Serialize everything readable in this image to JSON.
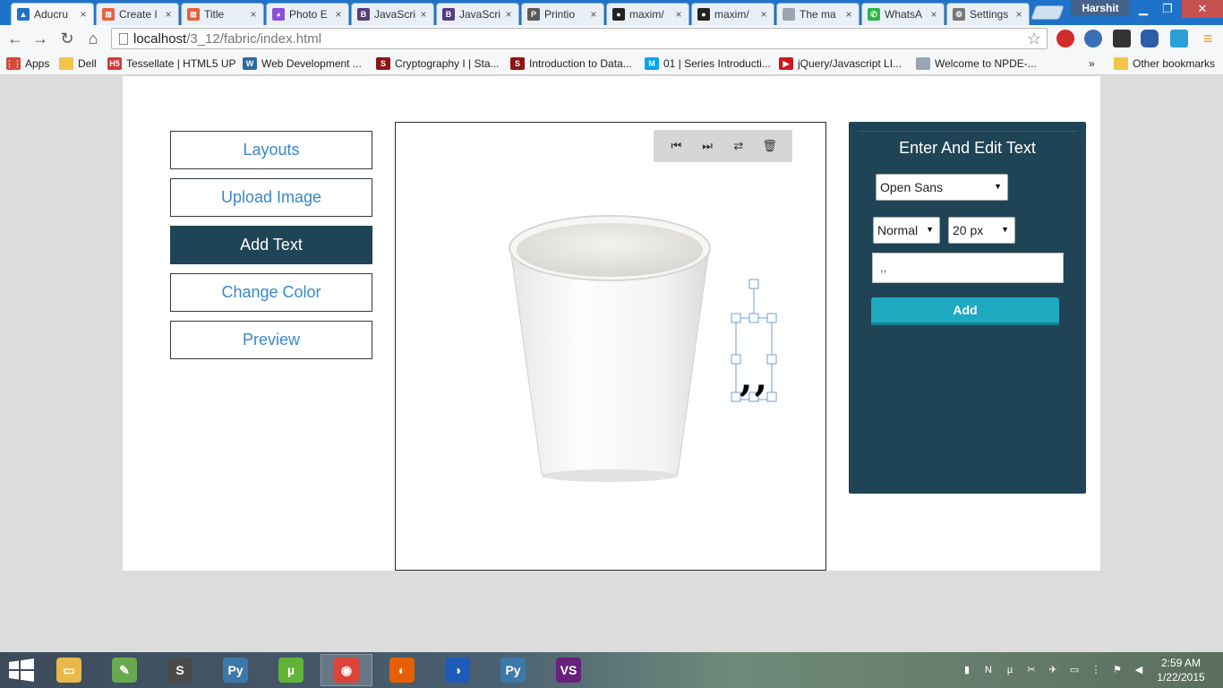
{
  "browser": {
    "tabs": [
      {
        "label": "Aducru",
        "active": true,
        "icon": "aducru-icon",
        "color": "#1e73c8",
        "glyph": "▲"
      },
      {
        "label": "Create I",
        "active": false,
        "icon": "xampp-icon",
        "color": "#e8603c",
        "glyph": "⊠"
      },
      {
        "label": "Title",
        "active": false,
        "icon": "xampp-icon",
        "color": "#e8603c",
        "glyph": "⊠"
      },
      {
        "label": "Photo E",
        "active": false,
        "icon": "colorwheel-icon",
        "color": "#8a4fd8",
        "glyph": "◕"
      },
      {
        "label": "JavaScri",
        "active": false,
        "icon": "bootstrap-icon",
        "color": "#563d7c",
        "glyph": "B"
      },
      {
        "label": "JavaScri",
        "active": false,
        "icon": "bootstrap-icon",
        "color": "#563d7c",
        "glyph": "B"
      },
      {
        "label": "Printio",
        "active": false,
        "icon": "printio-icon",
        "color": "#5a5a5a",
        "glyph": "P"
      },
      {
        "label": "maxim/",
        "active": false,
        "icon": "github-icon",
        "color": "#222222",
        "glyph": "●"
      },
      {
        "label": "maxim/",
        "active": false,
        "icon": "github-icon",
        "color": "#222222",
        "glyph": "●"
      },
      {
        "label": "The ma",
        "active": false,
        "icon": "page-icon",
        "color": "#9aa5b1",
        "glyph": ""
      },
      {
        "label": "WhatsA",
        "active": false,
        "icon": "whatsapp-icon",
        "color": "#2bb741",
        "glyph": "✆"
      },
      {
        "label": "Settings",
        "active": false,
        "icon": "gear-icon",
        "color": "#777777",
        "glyph": "⚙"
      }
    ],
    "profile_name": "Harshit",
    "url_host": "localhost",
    "url_path": "/3_12/fabric/index.html",
    "bookmarks": [
      {
        "label": "Apps",
        "icon": "apps-grid-icon",
        "color": "#d24a3a",
        "glyph": "⋮⋮"
      },
      {
        "label": "Dell",
        "icon": "folder-icon",
        "color": "#f2c54a",
        "glyph": ""
      },
      {
        "label": "Tessellate | HTML5 UP",
        "icon": "html5up-icon",
        "color": "#d23a3a",
        "glyph": "H5"
      },
      {
        "label": "Web Development ...",
        "icon": "webdev-icon",
        "color": "#2d6aa3",
        "glyph": "W"
      },
      {
        "label": "Cryptography I | Sta...",
        "icon": "stanford-icon",
        "color": "#8c1515",
        "glyph": "S"
      },
      {
        "label": "Introduction to Data...",
        "icon": "stanford-icon",
        "color": "#8c1515",
        "glyph": "S"
      },
      {
        "label": "01 | Series Introducti...",
        "icon": "mva-icon",
        "color": "#00a4ef",
        "glyph": "M"
      },
      {
        "label": "jQuery/Javascript LI...",
        "icon": "youtube-icon",
        "color": "#cc181e",
        "glyph": "▶"
      },
      {
        "label": "Welcome to NPDE-...",
        "icon": "page-icon",
        "color": "#9aa5b1",
        "glyph": ""
      }
    ],
    "overflow_label": "»",
    "other_bookmarks": "Other bookmarks"
  },
  "page": {
    "menu": [
      {
        "label": "Layouts",
        "active": false
      },
      {
        "label": "Upload Image",
        "active": false
      },
      {
        "label": "Add Text",
        "active": true
      },
      {
        "label": "Change Color",
        "active": false
      },
      {
        "label": "Preview",
        "active": false
      }
    ],
    "canvas_toolbar": [
      {
        "name": "send-backward-icon",
        "glyph": "⏮"
      },
      {
        "name": "bring-forward-icon",
        "glyph": "⏭"
      },
      {
        "name": "flip-icon",
        "glyph": "⇄"
      },
      {
        "name": "trash-icon",
        "glyph": "🗑"
      }
    ],
    "canvas_text": ",,",
    "text_panel": {
      "title": "Enter And Edit Text",
      "font_family": "Open Sans",
      "font_style": "Normal",
      "font_size": "20 px",
      "text_value": ",,",
      "add_label": "Add"
    }
  },
  "taskbar": {
    "apps": [
      {
        "name": "file-explorer-icon",
        "color": "#e8b84a",
        "glyph": "▭",
        "active": false
      },
      {
        "name": "notepad-icon",
        "color": "#6aa84f",
        "glyph": "✎",
        "active": false
      },
      {
        "name": "sublime-text-icon",
        "color": "#4a4a4a",
        "glyph": "S",
        "active": false
      },
      {
        "name": "python-icon",
        "color": "#3c78aa",
        "glyph": "Py",
        "active": false
      },
      {
        "name": "utorrent-icon",
        "color": "#5fb336",
        "glyph": "µ",
        "active": false
      },
      {
        "name": "chrome-icon",
        "color": "#db4437",
        "glyph": "◉",
        "active": true
      },
      {
        "name": "firefox-icon",
        "color": "#e66000",
        "glyph": "◐",
        "active": false
      },
      {
        "name": "firefox-dev-icon",
        "color": "#1e5bb8",
        "glyph": "◑",
        "active": false
      },
      {
        "name": "python-idle-icon",
        "color": "#3c78aa",
        "glyph": "Py",
        "active": false
      },
      {
        "name": "visual-studio-icon",
        "color": "#68217a",
        "glyph": "VS",
        "active": false
      }
    ],
    "time": "2:59 AM",
    "date": "1/22/2015"
  },
  "colors": {
    "panel_bg": "#1f4455",
    "add_button": "#1da9bf",
    "menu_text": "#3a87c9"
  }
}
